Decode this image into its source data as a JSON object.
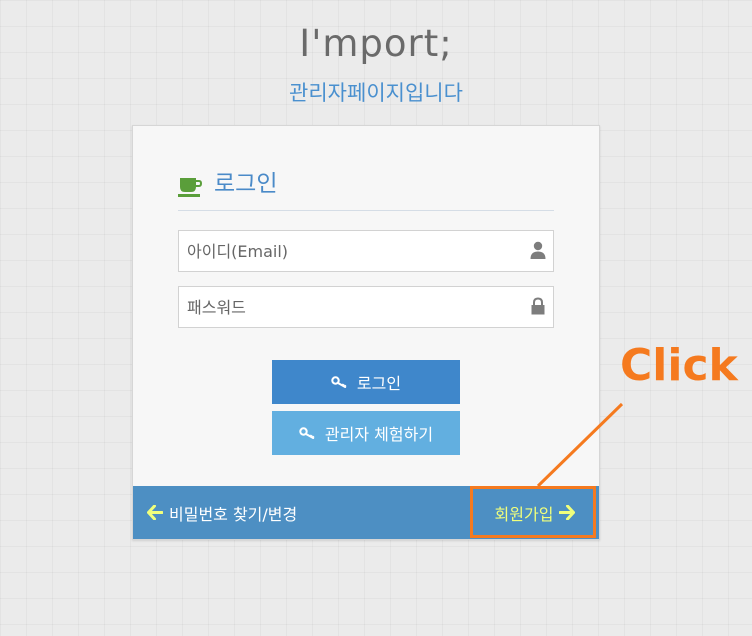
{
  "header": {
    "app_title": "I'mport;",
    "subtitle": "관리자페이지입니다"
  },
  "login_card": {
    "title": "로그인",
    "title_icon": "coffee-cup-icon",
    "email_placeholder": "아이디(Email)",
    "email_icon": "user-icon",
    "password_placeholder": "패스워드",
    "password_icon": "lock-icon",
    "login_button_label": "로그인",
    "demo_button_label": "관리자 체험하기",
    "button_icon": "key-icon"
  },
  "footer": {
    "find_password_label": "비밀번호 찾기/변경",
    "signup_label": "회원가입"
  },
  "annotation": {
    "label": "Click",
    "color": "#f57a1f"
  },
  "colors": {
    "accent": "#3f87cb",
    "secondary_button": "#62afe0",
    "footer": "#4d8fc3",
    "signup_text": "#f0ff7c",
    "cup_icon": "#5a9e3a"
  }
}
